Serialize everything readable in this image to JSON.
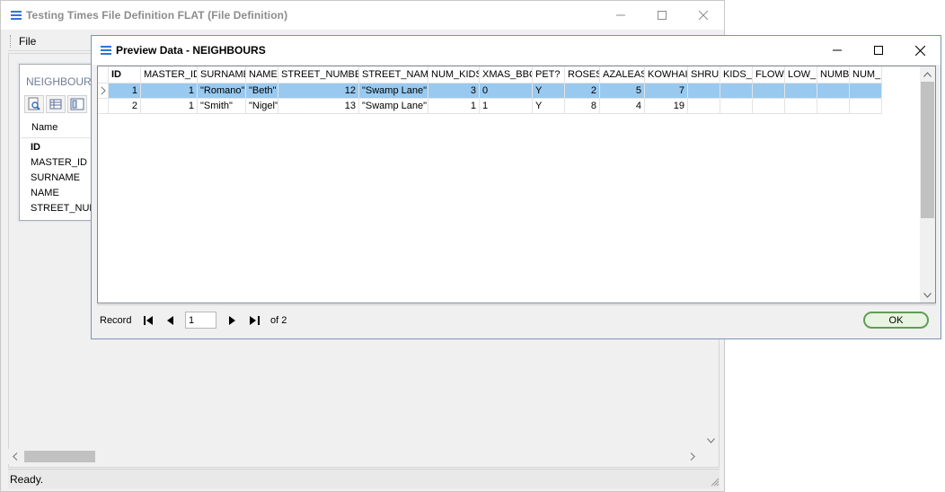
{
  "main_window": {
    "title": "Testing Times File Definition FLAT (File Definition)",
    "menu": {
      "file": "File"
    },
    "panel": {
      "title": "NEIGHBOURS",
      "column_header": "Name",
      "fields": [
        "ID",
        "MASTER_ID",
        "SURNAME",
        "NAME",
        "STREET_NUMBER"
      ]
    },
    "status": "Ready."
  },
  "dialog": {
    "title": "Preview Data - NEIGHBOURS",
    "columns": [
      "ID",
      "MASTER_ID",
      "SURNAME",
      "NAME",
      "STREET_NUMBER",
      "STREET_NAME",
      "NUM_KIDS",
      "XMAS_BBQ",
      "PET?",
      "ROSES",
      "AZALEAS",
      "KOWHAI",
      "SHRUB",
      "KIDS_F",
      "FLOWE",
      "LOW_N",
      "NUMBE",
      "NUM_E"
    ],
    "rows": [
      [
        "1",
        "1",
        "\"Romano\"",
        "\"Beth\"",
        "12",
        "\"Swamp Lane\"",
        "3",
        "0",
        "Y",
        "2",
        "5",
        "7",
        "",
        "",
        "",
        "",
        "",
        ""
      ],
      [
        "2",
        "1",
        "\"Smith\"",
        "\"Nigel\"",
        "13",
        "\"Swamp Lane\"",
        "1",
        "1",
        "Y",
        "8",
        "4",
        "19",
        "",
        "",
        "",
        "",
        "",
        ""
      ]
    ],
    "selected_row": 0,
    "navigator": {
      "record_label": "Record",
      "current_record": "1",
      "of_total": "of 2"
    },
    "ok_label": "OK",
    "selection_color": "#99c9ef",
    "ok_border_color": "#5f9e55"
  }
}
